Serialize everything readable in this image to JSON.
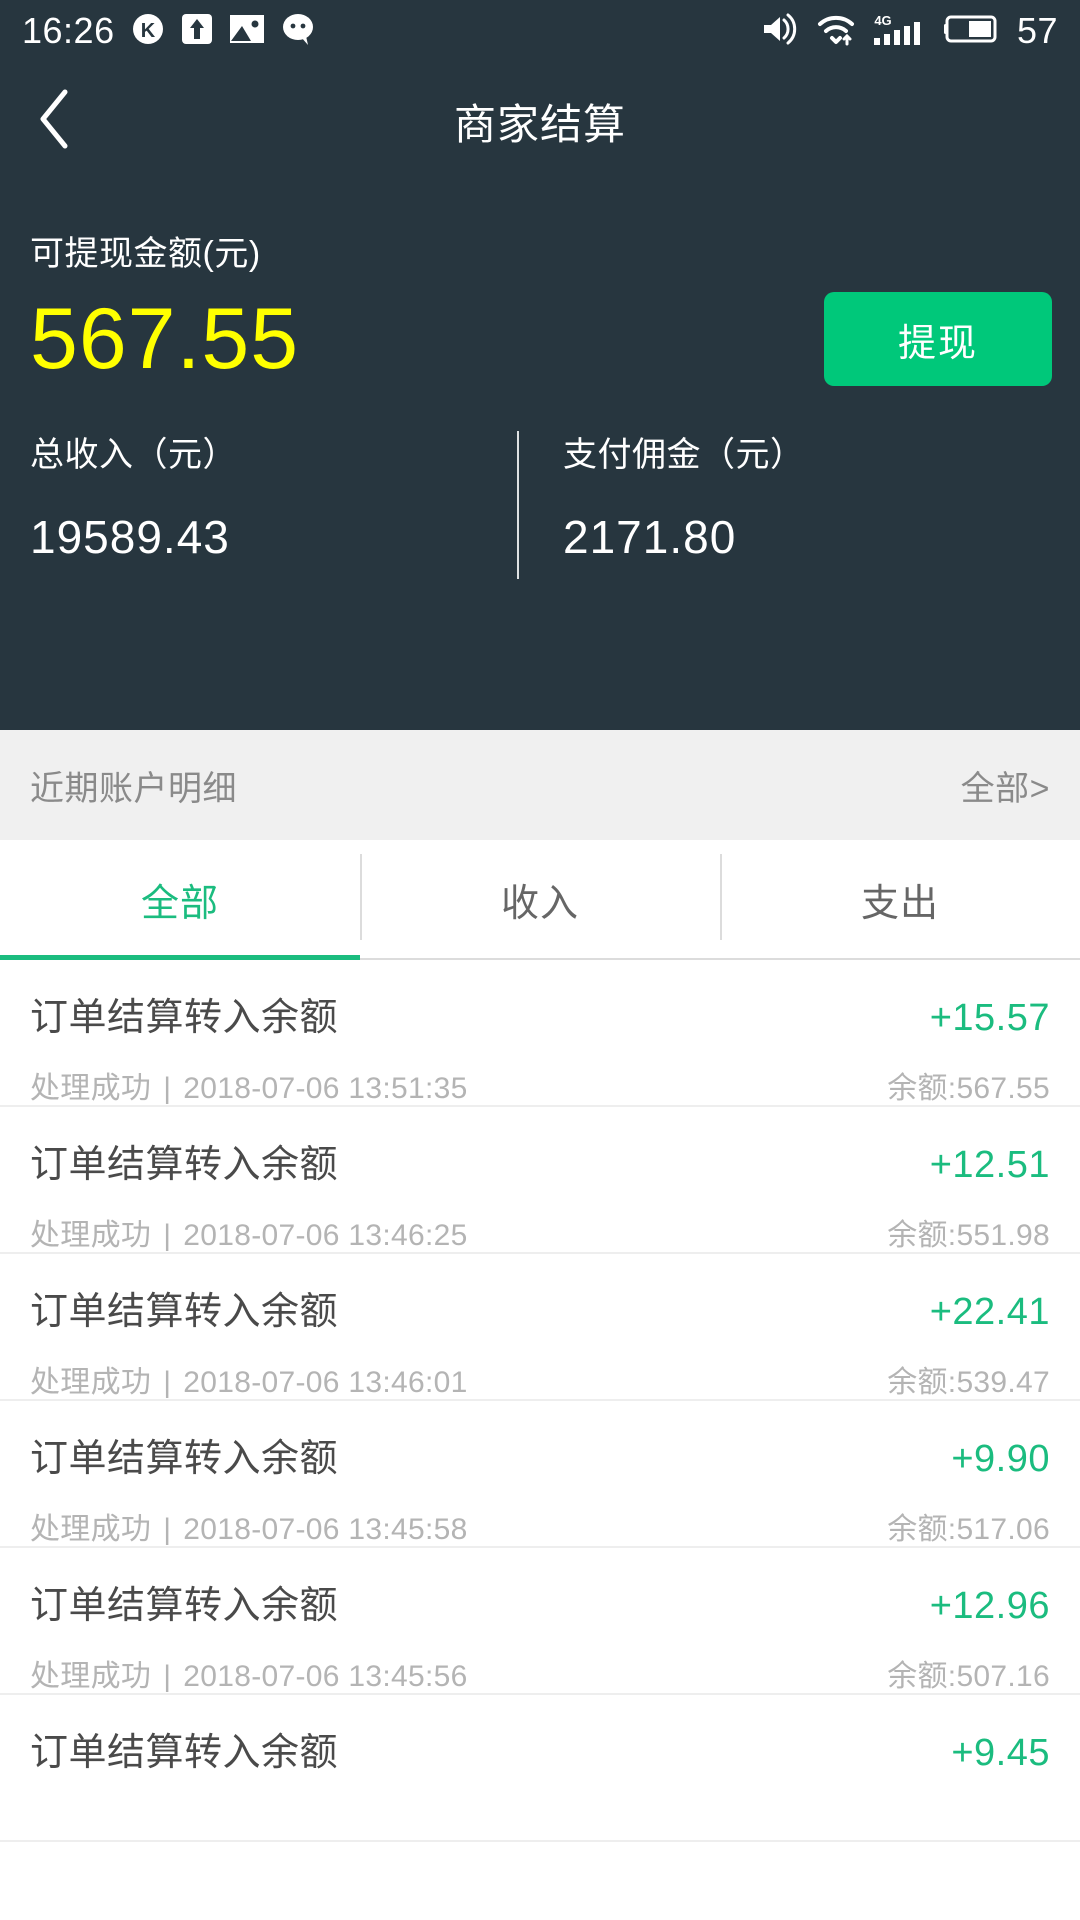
{
  "statusbar": {
    "time": "16:26",
    "battery_level": "57",
    "network_type": "4G",
    "left_icons": [
      "kugou-k-icon",
      "upload-arrow-icon",
      "image-icon",
      "chat-bubble-icon"
    ],
    "right_icons": [
      "ringer-sound-icon",
      "wifi-icon",
      "signal-bars-icon",
      "battery-icon"
    ]
  },
  "header": {
    "back_label": "back-chevron",
    "title": "商家结算"
  },
  "balance": {
    "label": "可提现金额(元)",
    "amount": "567.55",
    "amount_color": "#ffff00",
    "withdraw_button": "提现",
    "button_color": "#00c87a"
  },
  "stats": [
    {
      "label": "总收入（元）",
      "value": "19589.43"
    },
    {
      "label": "支付佣金（元）",
      "value": "2171.80"
    }
  ],
  "section": {
    "title": "近期账户明细",
    "more": "全部>"
  },
  "tabs": [
    {
      "label": "全部",
      "active": true
    },
    {
      "label": "收入",
      "active": false
    },
    {
      "label": "支出",
      "active": false
    }
  ],
  "transactions": [
    {
      "title": "订单结算转入余额",
      "amount": "+15.57",
      "status": "处理成功",
      "separator": "|",
      "datetime": "2018-07-06 13:51:35",
      "balance": "余额:567.55"
    },
    {
      "title": "订单结算转入余额",
      "amount": "+12.51",
      "status": "处理成功",
      "separator": "|",
      "datetime": "2018-07-06 13:46:25",
      "balance": "余额:551.98"
    },
    {
      "title": "订单结算转入余额",
      "amount": "+22.41",
      "status": "处理成功",
      "separator": "|",
      "datetime": "2018-07-06 13:46:01",
      "balance": "余额:539.47"
    },
    {
      "title": "订单结算转入余额",
      "amount": "+9.90",
      "status": "处理成功",
      "separator": "|",
      "datetime": "2018-07-06 13:45:58",
      "balance": "余额:517.06"
    },
    {
      "title": "订单结算转入余额",
      "amount": "+12.96",
      "status": "处理成功",
      "separator": "|",
      "datetime": "2018-07-06 13:45:56",
      "balance": "余额:507.16"
    },
    {
      "title": "订单结算转入余额",
      "amount": "+9.45",
      "status": "",
      "separator": "",
      "datetime": "",
      "balance": ""
    }
  ],
  "colors": {
    "dark_bg": "#27363f",
    "accent_green": "#1bbc7f",
    "button_green": "#00c87a",
    "amount_yellow": "#ffff00",
    "section_bg": "#f0f0f0"
  }
}
